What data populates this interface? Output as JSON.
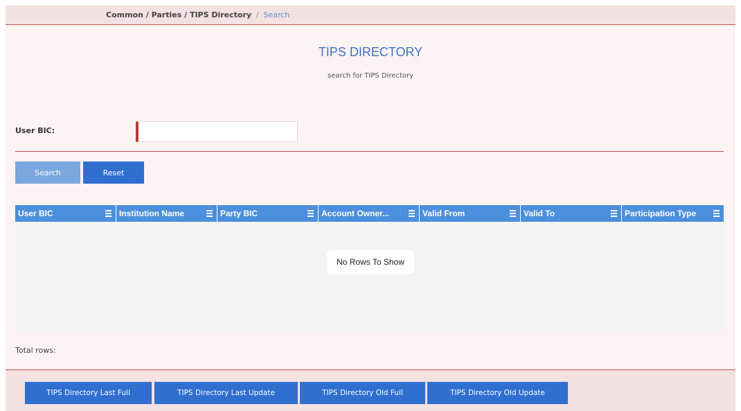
{
  "breadcrumb": {
    "path": "Common / Parties / TIPS Directory",
    "separator": "/",
    "current": "Search"
  },
  "header": {
    "title": "TIPS DIRECTORY",
    "subtitle": "search for TIPS Directory"
  },
  "form": {
    "user_bic_label": "User BIC:",
    "user_bic_value": ""
  },
  "buttons": {
    "search": "Search",
    "reset": "Reset"
  },
  "table": {
    "columns": [
      {
        "label": "User BIC",
        "icon": "menu-icon"
      },
      {
        "label": "Institution Name",
        "icon": "menu-icon"
      },
      {
        "label": "Party BIC",
        "icon": "menu-icon"
      },
      {
        "label": "Account Owner...",
        "icon": "menu-icon"
      },
      {
        "label": "Valid From",
        "icon": "menu-icon"
      },
      {
        "label": "Valid To",
        "icon": "menu-icon"
      },
      {
        "label": "Participation Type",
        "icon": "menu-icon"
      }
    ],
    "rows": [],
    "empty_message": "No Rows To Show"
  },
  "total_rows_label": "Total rows:",
  "footer_buttons": {
    "last_full": "TIPS Directory Last Full",
    "last_update": "TIPS Directory Last Update",
    "old_full": "TIPS Directory Old Full",
    "old_update": "TIPS Directory Old Update"
  },
  "colors": {
    "accent": "#2f6fcf",
    "header_blue": "#4c8fdc",
    "divider_red": "#c0504d",
    "page_bg": "#fcf3f3"
  }
}
